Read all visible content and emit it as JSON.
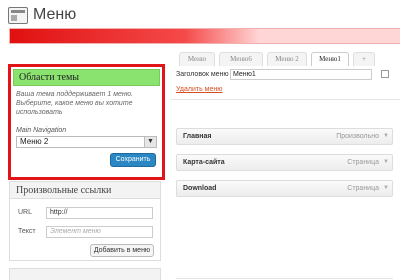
{
  "header": {
    "title": "Меню"
  },
  "tabs": [
    {
      "label": "Меню"
    },
    {
      "label": "Меню6"
    },
    {
      "label": "Меню 2"
    },
    {
      "label": "Меню1"
    },
    {
      "label": "+"
    }
  ],
  "locations": {
    "title": "Области темы",
    "note": "Ваша тема поддерживает 1 меню. Выберите, какое меню вы хотите использовать",
    "label": "Main Navigation",
    "selected": "Меню 2",
    "save_label": "Сохранить"
  },
  "custom_links": {
    "title": "Произвольные ссылки",
    "url_label": "URL",
    "url_value": "http://",
    "text_label": "Текст",
    "text_placeholder": "Элемент меню",
    "add_label": "Добавить в меню"
  },
  "editor": {
    "name_label": "Заголовок меню",
    "name_value": "Меню1",
    "delete_label": "Удалить меню",
    "items": [
      {
        "title": "Главная",
        "type": "Произвольно"
      },
      {
        "title": "Карта-сайта",
        "type": "Страница"
      },
      {
        "title": "Download",
        "type": "Страница"
      }
    ]
  },
  "colors": {
    "highlight_border": "#e1141a",
    "location_header": "#8ae36f",
    "primary_button": "#2b87c3",
    "delete_link": "#d54e21"
  }
}
